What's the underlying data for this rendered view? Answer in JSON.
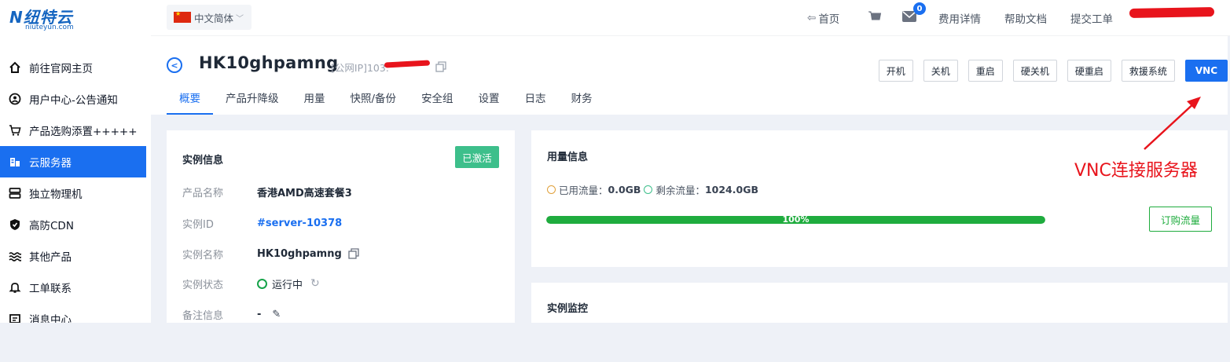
{
  "brand": {
    "logo_text": "N纽特云",
    "logo_sub": "niuteyun.com"
  },
  "sidebar": {
    "items": [
      {
        "label": "前往官网主页",
        "icon": "home-icon"
      },
      {
        "label": "用户中心-公告通知",
        "icon": "user-circle-icon"
      },
      {
        "label": "产品选购添置+++++",
        "icon": "cart-icon"
      },
      {
        "label": "云服务器",
        "icon": "cloud-server-icon",
        "active": true
      },
      {
        "label": "独立物理机",
        "icon": "server-icon"
      },
      {
        "label": "高防CDN",
        "icon": "shield-icon"
      },
      {
        "label": "其他产品",
        "icon": "waves-icon"
      },
      {
        "label": "工单联系",
        "icon": "bell-icon"
      },
      {
        "label": "消息中心",
        "icon": "message-icon"
      }
    ]
  },
  "topbar": {
    "language": "中文简体",
    "home": "首页",
    "mail_count": "0",
    "fee": "费用详情",
    "help": "帮助文档",
    "ticket": "提交工单"
  },
  "header": {
    "title": "HK10ghpamng",
    "ip_label": "[公网IP]103.",
    "actions": [
      "开机",
      "关机",
      "重启",
      "硬关机",
      "硬重启",
      "救援系统",
      "VNC"
    ],
    "tabs": [
      "概要",
      "产品升降级",
      "用量",
      "快照/备份",
      "安全组",
      "设置",
      "日志",
      "财务"
    ]
  },
  "instance": {
    "title": "实例信息",
    "status_badge": "已激活",
    "rows": [
      {
        "label": "产品名称",
        "value": "香港AMD高速套餐3"
      },
      {
        "label": "实例ID",
        "value": "#server-10378"
      },
      {
        "label": "实例名称",
        "value": "HK10ghpamng"
      },
      {
        "label": "实例状态",
        "value": "运行中"
      },
      {
        "label": "备注信息",
        "value": "-"
      }
    ]
  },
  "usage": {
    "title": "用量信息",
    "used_label": "已用流量：",
    "used_value": "0.0GB",
    "remain_label": "剩余流量：",
    "remain_value": "1024.0GB",
    "progress_text": "100%",
    "progress_fraction": 1.0,
    "buy_button": "订购流量"
  },
  "monitor": {
    "title": "实例监控"
  },
  "annotation": {
    "text": "VNC连接服务器",
    "color": "#e8141c"
  },
  "colors": {
    "accent": "#1a6ff0",
    "success": "#1fac3e",
    "active_badge": "#3dbf8b",
    "running": "#16a34a",
    "used_ring": "#e0a03a",
    "remain_ring": "#3dbf8b"
  }
}
